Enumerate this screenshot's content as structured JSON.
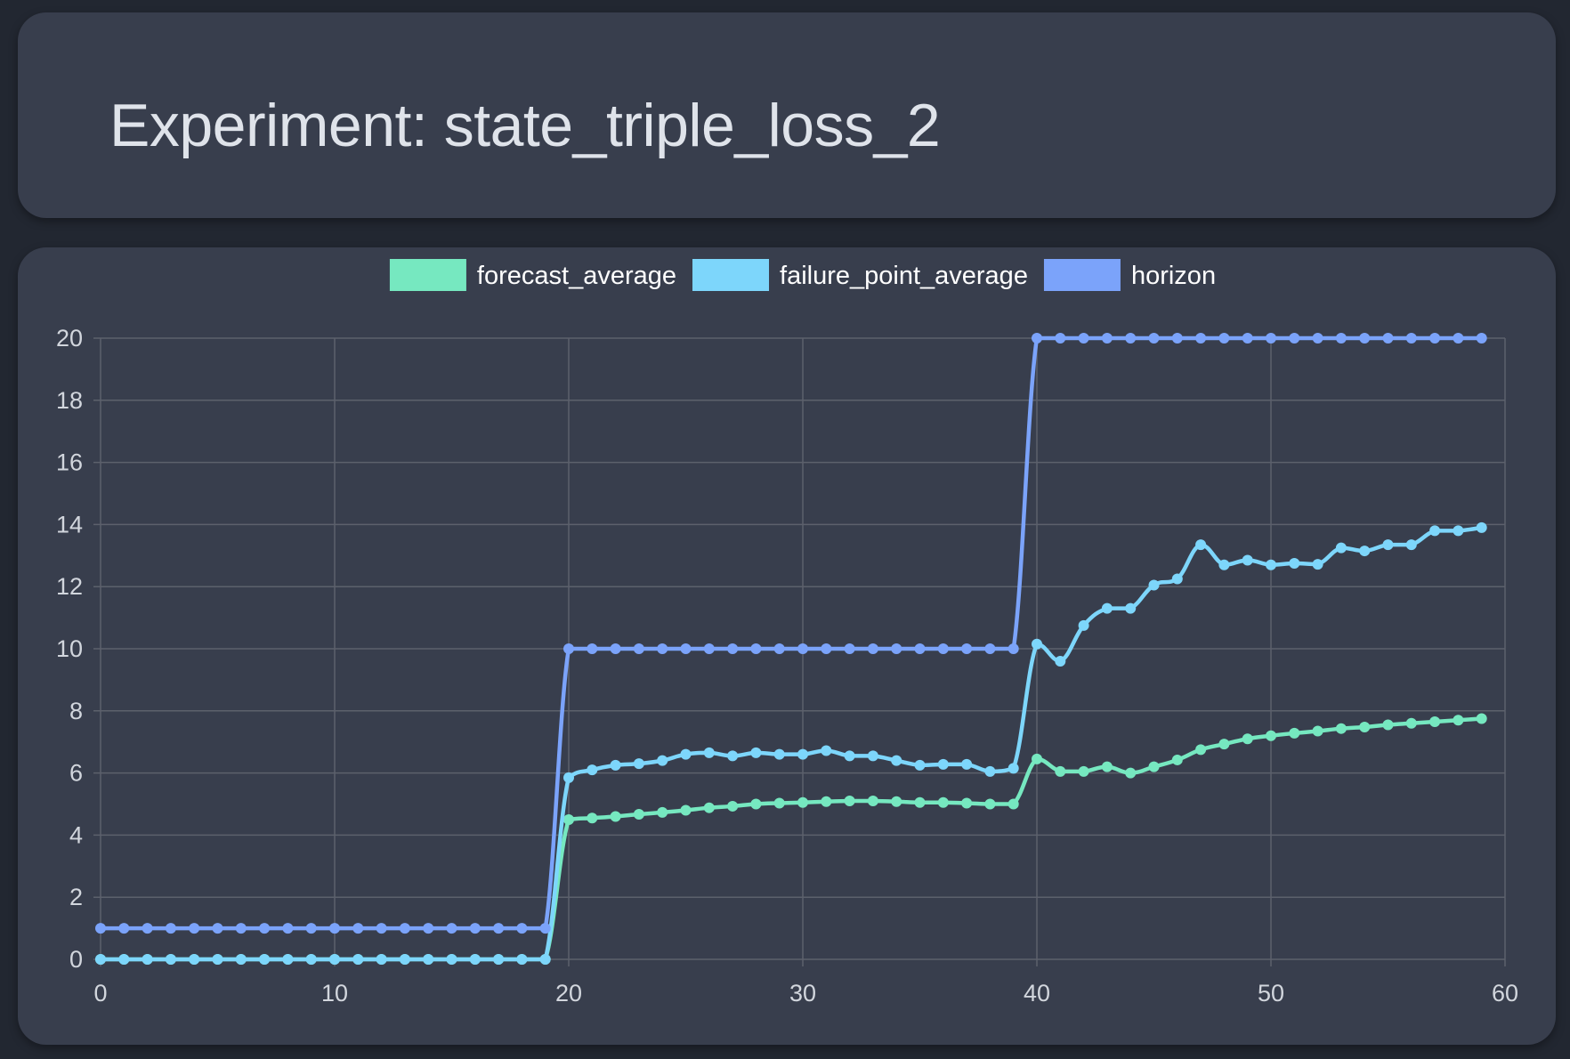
{
  "header": {
    "title": "Experiment: state_triple_loss_2"
  },
  "chart_data": {
    "type": "line",
    "xlim": [
      0,
      60
    ],
    "ylim": [
      0,
      20
    ],
    "x_ticks": [
      0,
      10,
      20,
      30,
      40,
      50,
      60
    ],
    "y_ticks": [
      0,
      2,
      4,
      6,
      8,
      10,
      12,
      14,
      16,
      18,
      20
    ],
    "grid": true,
    "legend_position": "top",
    "x": [
      0,
      1,
      2,
      3,
      4,
      5,
      6,
      7,
      8,
      9,
      10,
      11,
      12,
      13,
      14,
      15,
      16,
      17,
      18,
      19,
      20,
      21,
      22,
      23,
      24,
      25,
      26,
      27,
      28,
      29,
      30,
      31,
      32,
      33,
      34,
      35,
      36,
      37,
      38,
      39,
      40,
      41,
      42,
      43,
      44,
      45,
      46,
      47,
      48,
      49,
      50,
      51,
      52,
      53,
      54,
      55,
      56,
      57,
      58,
      59
    ],
    "series": [
      {
        "name": "forecast_average",
        "color": "#76e8c0",
        "values": [
          0,
          0,
          0,
          0,
          0,
          0,
          0,
          0,
          0,
          0,
          0,
          0,
          0,
          0,
          0,
          0,
          0,
          0,
          0,
          0,
          4.5,
          4.55,
          4.6,
          4.67,
          4.73,
          4.8,
          4.88,
          4.93,
          5.0,
          5.03,
          5.05,
          5.08,
          5.1,
          5.1,
          5.08,
          5.05,
          5.05,
          5.03,
          5.0,
          5.0,
          6.45,
          6.05,
          6.05,
          6.2,
          6.0,
          6.2,
          6.42,
          6.75,
          6.93,
          7.1,
          7.2,
          7.28,
          7.35,
          7.43,
          7.48,
          7.55,
          7.6,
          7.65,
          7.7,
          7.75
        ]
      },
      {
        "name": "failure_point_average",
        "color": "#7dd6fb",
        "values": [
          0,
          0,
          0,
          0,
          0,
          0,
          0,
          0,
          0,
          0,
          0,
          0,
          0,
          0,
          0,
          0,
          0,
          0,
          0,
          0,
          5.85,
          6.1,
          6.25,
          6.3,
          6.4,
          6.6,
          6.65,
          6.55,
          6.65,
          6.6,
          6.6,
          6.72,
          6.55,
          6.55,
          6.4,
          6.25,
          6.28,
          6.28,
          6.05,
          6.15,
          10.15,
          9.6,
          10.75,
          11.3,
          11.3,
          12.05,
          12.25,
          13.35,
          12.7,
          12.85,
          12.7,
          12.75,
          12.72,
          13.25,
          13.15,
          13.35,
          13.35,
          13.8,
          13.8,
          13.9
        ]
      },
      {
        "name": "horizon",
        "color": "#7ba3fa",
        "values": [
          1,
          1,
          1,
          1,
          1,
          1,
          1,
          1,
          1,
          1,
          1,
          1,
          1,
          1,
          1,
          1,
          1,
          1,
          1,
          1,
          10,
          10,
          10,
          10,
          10,
          10,
          10,
          10,
          10,
          10,
          10,
          10,
          10,
          10,
          10,
          10,
          10,
          10,
          10,
          10,
          20,
          20,
          20,
          20,
          20,
          20,
          20,
          20,
          20,
          20,
          20,
          20,
          20,
          20,
          20,
          20,
          20,
          20,
          20,
          20
        ]
      }
    ]
  }
}
